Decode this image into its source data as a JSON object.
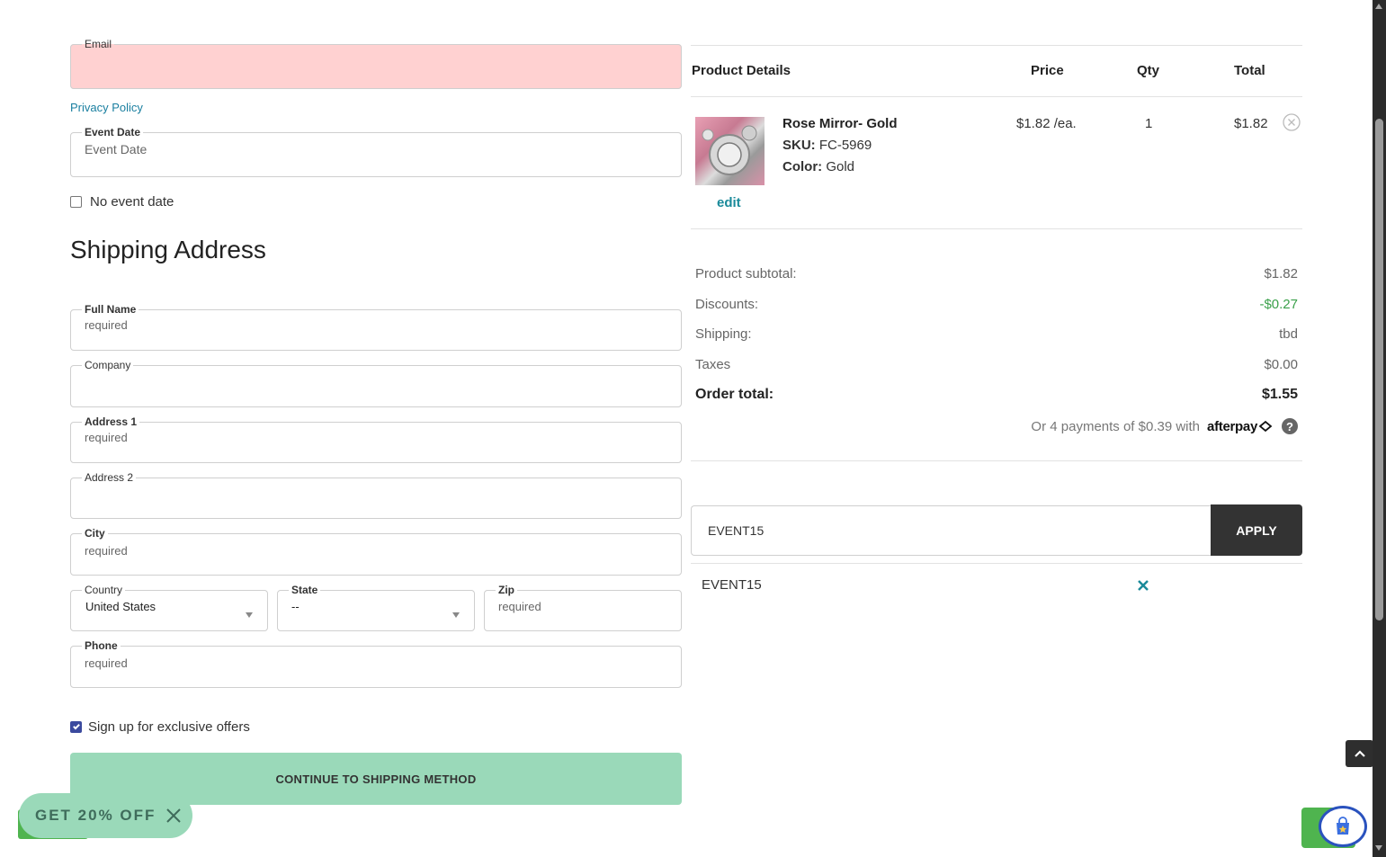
{
  "form": {
    "email": {
      "legend": "Email",
      "value": ""
    },
    "privacy_link": "Privacy Policy",
    "event_date": {
      "legend": "Event Date",
      "placeholder": "Event Date"
    },
    "no_event_date": "No event date",
    "shipping_heading": "Shipping Address",
    "full_name": {
      "legend": "Full Name",
      "placeholder": "required"
    },
    "company": {
      "legend": "Company",
      "placeholder": ""
    },
    "address1": {
      "legend": "Address 1",
      "placeholder": "required"
    },
    "address2": {
      "legend": "Address 2",
      "placeholder": ""
    },
    "city": {
      "legend": "City",
      "placeholder": "required"
    },
    "country": {
      "legend": "Country",
      "value": "United States"
    },
    "state": {
      "legend": "State",
      "value": "--"
    },
    "zip": {
      "legend": "Zip",
      "placeholder": "required"
    },
    "phone": {
      "legend": "Phone",
      "placeholder": "required"
    },
    "signup": "Sign up for exclusive offers",
    "continue_button": "CONTINUE TO SHIPPING METHOD"
  },
  "promo_popup": {
    "label": "GET 20% OFF"
  },
  "cart": {
    "headers": {
      "product": "Product Details",
      "price": "Price",
      "qty": "Qty",
      "total": "Total"
    },
    "item": {
      "name": "Rose Mirror- Gold",
      "sku_label": "SKU:",
      "sku": "FC-5969",
      "color_label": "Color:",
      "color": "Gold",
      "edit": "edit",
      "price": "$1.82 /ea.",
      "qty": "1",
      "total": "$1.82"
    },
    "summary": {
      "subtotal_label": "Product subtotal:",
      "subtotal": "$1.82",
      "discounts_label": "Discounts:",
      "discounts": "-$0.27",
      "shipping_label": "Shipping:",
      "shipping": "tbd",
      "taxes_label": "Taxes",
      "taxes": "$0.00",
      "order_total_label": "Order total:",
      "order_total": "$1.55",
      "afterpay_text": "Or 4 payments of $0.39 with",
      "afterpay_brand": "afterpay"
    },
    "coupon": {
      "value": "EVENT15",
      "apply": "APPLY",
      "applied_code": "EVENT15"
    }
  },
  "colors": {
    "accent": "#1a8a9a",
    "button_green": "#9ad9b9",
    "error_bg": "#ffd1d1",
    "discount_green": "#3aa04a"
  }
}
